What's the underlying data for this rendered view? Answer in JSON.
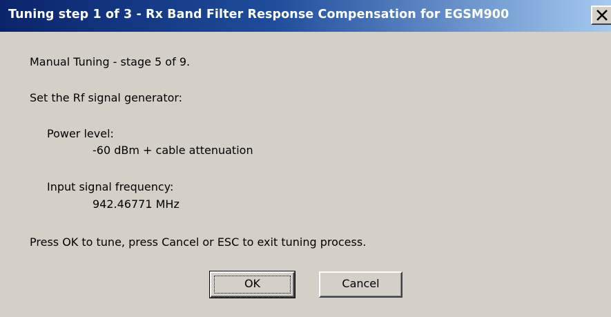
{
  "window": {
    "title": "Tuning step 1 of 3 - Rx Band Filter Response Compensation for EGSM900",
    "close_icon": "close-icon"
  },
  "content": {
    "stage_text": "Manual Tuning - stage 5 of 9.",
    "instruction_text": "Set the Rf signal generator:",
    "power_label": "Power level:",
    "power_value": "-60 dBm + cable attenuation",
    "frequency_label": "Input signal frequency:",
    "frequency_value": "942.46771 MHz",
    "prompt_text": "Press OK to tune, press Cancel or ESC to exit tuning process."
  },
  "buttons": {
    "ok_label": "OK",
    "cancel_label": "Cancel"
  },
  "colors": {
    "titlebar_start": "#0a246a",
    "titlebar_end": "#a6caf0",
    "dialog_background": "#d4d0c8"
  }
}
